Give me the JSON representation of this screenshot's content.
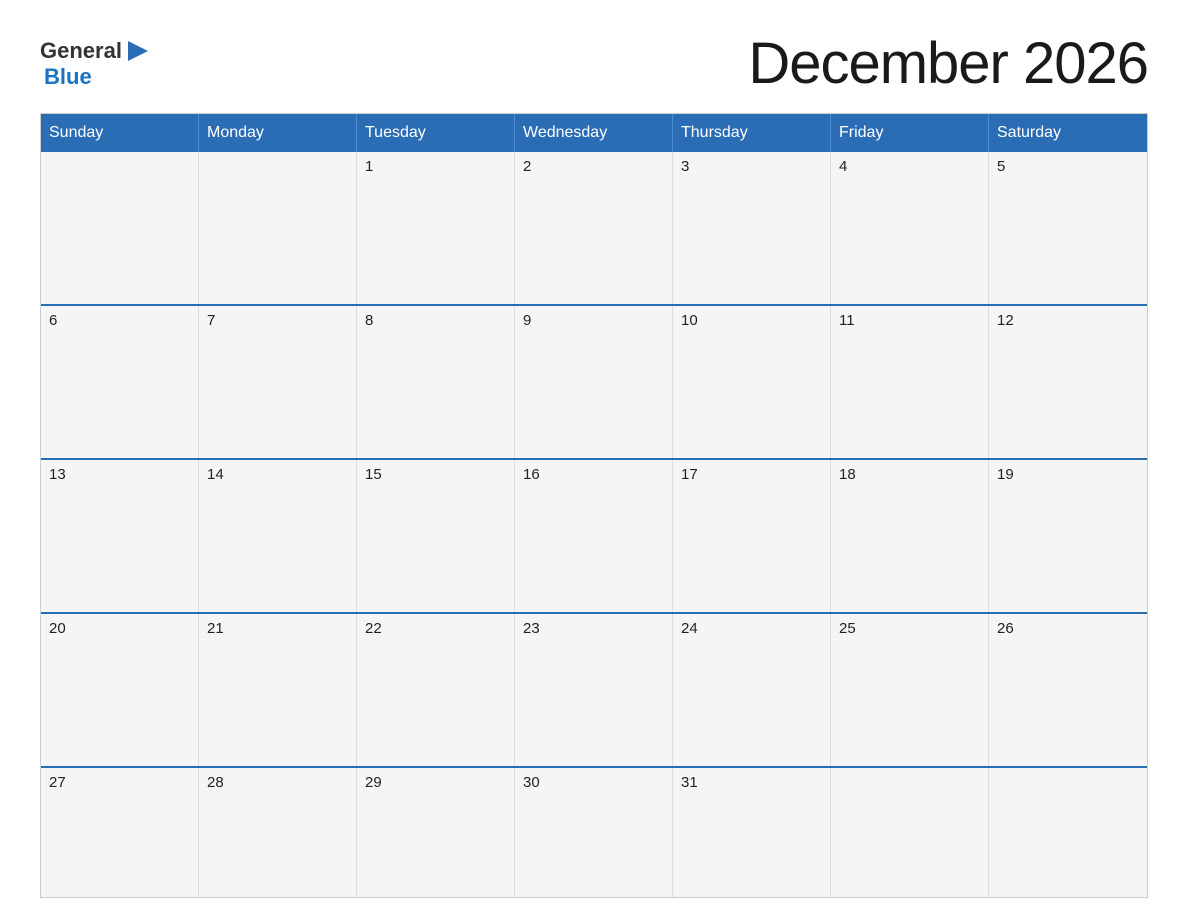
{
  "logo": {
    "general": "General",
    "blue": "Blue"
  },
  "title": "December 2026",
  "headers": [
    "Sunday",
    "Monday",
    "Tuesday",
    "Wednesday",
    "Thursday",
    "Friday",
    "Saturday"
  ],
  "weeks": [
    [
      {
        "day": "",
        "empty": true
      },
      {
        "day": "",
        "empty": true
      },
      {
        "day": "1",
        "empty": false
      },
      {
        "day": "2",
        "empty": false
      },
      {
        "day": "3",
        "empty": false
      },
      {
        "day": "4",
        "empty": false
      },
      {
        "day": "5",
        "empty": false
      }
    ],
    [
      {
        "day": "6",
        "empty": false
      },
      {
        "day": "7",
        "empty": false
      },
      {
        "day": "8",
        "empty": false
      },
      {
        "day": "9",
        "empty": false
      },
      {
        "day": "10",
        "empty": false
      },
      {
        "day": "11",
        "empty": false
      },
      {
        "day": "12",
        "empty": false
      }
    ],
    [
      {
        "day": "13",
        "empty": false
      },
      {
        "day": "14",
        "empty": false
      },
      {
        "day": "15",
        "empty": false
      },
      {
        "day": "16",
        "empty": false
      },
      {
        "day": "17",
        "empty": false
      },
      {
        "day": "18",
        "empty": false
      },
      {
        "day": "19",
        "empty": false
      }
    ],
    [
      {
        "day": "20",
        "empty": false
      },
      {
        "day": "21",
        "empty": false
      },
      {
        "day": "22",
        "empty": false
      },
      {
        "day": "23",
        "empty": false
      },
      {
        "day": "24",
        "empty": false
      },
      {
        "day": "25",
        "empty": false
      },
      {
        "day": "26",
        "empty": false
      }
    ],
    [
      {
        "day": "27",
        "empty": false
      },
      {
        "day": "28",
        "empty": false
      },
      {
        "day": "29",
        "empty": false
      },
      {
        "day": "30",
        "empty": false
      },
      {
        "day": "31",
        "empty": false
      },
      {
        "day": "",
        "empty": true
      },
      {
        "day": "",
        "empty": true
      }
    ]
  ]
}
